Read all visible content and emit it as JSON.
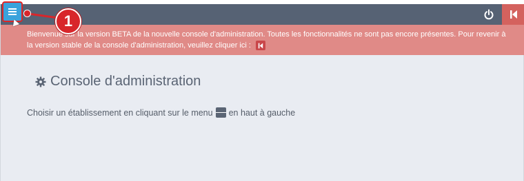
{
  "topbar": {
    "menu_icon": "hamburger-menu-icon",
    "power_icon": "power-icon",
    "back_icon": "skip-back-icon"
  },
  "callout": {
    "number": "1"
  },
  "banner": {
    "text": "Bienvenue sur la version BETA de la nouvelle console d'administration. Toutes les fonctionnalités ne sont pas encore présentes. Pour revenir à la version stable de la console d'administration, veuillez cliquer ici :"
  },
  "main": {
    "title": "Console d'administration",
    "title_icon": "gear-icon",
    "hint_before": "Choisir un établissement en cliquant sur le menu",
    "hint_after": "en haut à gauche"
  },
  "colors": {
    "topbar": "#566274",
    "accent": "#3aa3dc",
    "banner": "#e08a87",
    "callout": "#d8262b"
  }
}
